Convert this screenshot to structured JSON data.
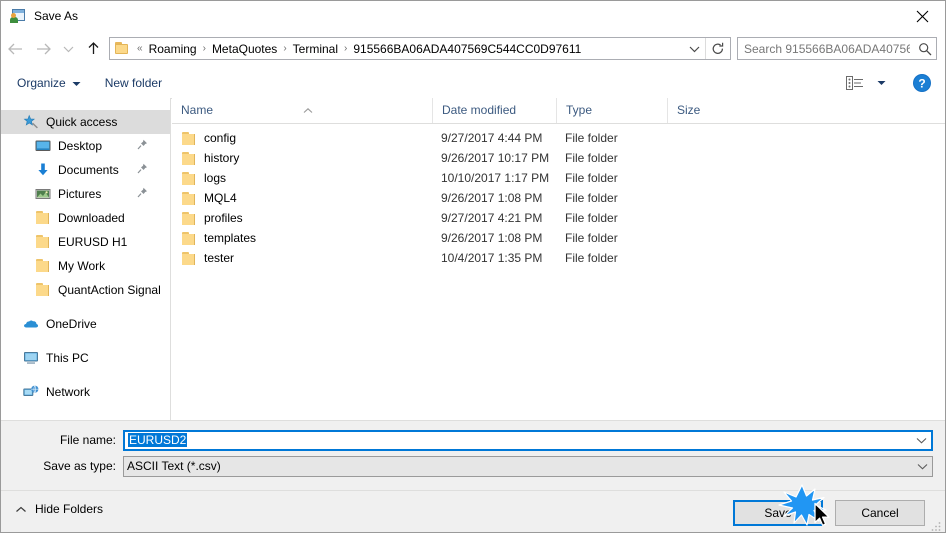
{
  "window": {
    "title": "Save As",
    "app_icon": "save-as-app-icon",
    "close_label": "✕"
  },
  "nav": {
    "back_icon": "arrow-left-icon",
    "forward_icon": "arrow-right-icon",
    "recent_icon": "chevron-down-icon",
    "up_icon": "arrow-up-icon",
    "breadcrumb_prefix": "«",
    "breadcrumbs": [
      "Roaming",
      "MetaQuotes",
      "Terminal",
      "915566BA06ADA407569C544CC0D97611"
    ],
    "separator": "›",
    "dropdown_icon": "chevron-down-icon",
    "refresh_icon": "refresh-icon"
  },
  "search": {
    "placeholder": "Search 915566BA06ADA40756...",
    "value": "",
    "icon": "search-icon"
  },
  "toolbar": {
    "organize_label": "Organize",
    "organize_icon": "chevron-down-icon",
    "new_folder_label": "New folder",
    "view_icon": "view-list-icon",
    "view_dropdown_icon": "chevron-down-icon",
    "help_icon": "help-icon",
    "help_label": "?"
  },
  "sidebar": {
    "groups": [
      {
        "items": [
          {
            "label": "Quick access",
            "icon": "star-pin-icon",
            "selected": true,
            "indent": false,
            "pinned": false
          },
          {
            "label": "Desktop",
            "icon": "desktop-icon",
            "selected": false,
            "indent": true,
            "pinned": true
          },
          {
            "label": "Documents",
            "icon": "documents-icon",
            "selected": false,
            "indent": true,
            "pinned": true
          },
          {
            "label": "Pictures",
            "icon": "pictures-icon",
            "selected": false,
            "indent": true,
            "pinned": true
          },
          {
            "label": "Downloaded",
            "icon": "folder-icon",
            "selected": false,
            "indent": true,
            "pinned": false
          },
          {
            "label": "EURUSD H1",
            "icon": "folder-icon",
            "selected": false,
            "indent": true,
            "pinned": false
          },
          {
            "label": "My Work",
            "icon": "folder-icon",
            "selected": false,
            "indent": true,
            "pinned": false
          },
          {
            "label": "QuantAction Signal",
            "icon": "folder-icon",
            "selected": false,
            "indent": true,
            "pinned": false
          }
        ]
      },
      {
        "items": [
          {
            "label": "OneDrive",
            "icon": "onedrive-cloud-icon",
            "selected": false,
            "indent": false,
            "pinned": false
          }
        ]
      },
      {
        "items": [
          {
            "label": "This PC",
            "icon": "this-pc-icon",
            "selected": false,
            "indent": false,
            "pinned": false
          }
        ]
      },
      {
        "items": [
          {
            "label": "Network",
            "icon": "network-icon",
            "selected": false,
            "indent": false,
            "pinned": false
          }
        ]
      }
    ]
  },
  "filelist": {
    "columns": [
      "Name",
      "Date modified",
      "Type",
      "Size"
    ],
    "sort_column": "Name",
    "sort_direction": "ascending",
    "rows": [
      {
        "name": "config",
        "date": "9/27/2017 4:44 PM",
        "type": "File folder",
        "size": ""
      },
      {
        "name": "history",
        "date": "9/26/2017 10:17 PM",
        "type": "File folder",
        "size": ""
      },
      {
        "name": "logs",
        "date": "10/10/2017 1:17 PM",
        "type": "File folder",
        "size": ""
      },
      {
        "name": "MQL4",
        "date": "9/26/2017 1:08 PM",
        "type": "File folder",
        "size": ""
      },
      {
        "name": "profiles",
        "date": "9/27/2017 4:21 PM",
        "type": "File folder",
        "size": ""
      },
      {
        "name": "templates",
        "date": "9/26/2017 1:08 PM",
        "type": "File folder",
        "size": ""
      },
      {
        "name": "tester",
        "date": "10/4/2017 1:35 PM",
        "type": "File folder",
        "size": ""
      }
    ]
  },
  "form": {
    "filename_label": "File name:",
    "filename_value": "EURUSD2",
    "filename_selected": true,
    "filetype_label": "Save as type:",
    "filetype_value": "ASCII Text (*.csv)",
    "dropdown_icon": "chevron-down-icon"
  },
  "footer": {
    "hide_folders_label": "Hide Folders",
    "hide_folders_icon": "chevron-up-icon",
    "save_label": "Save",
    "cancel_label": "Cancel"
  },
  "colors": {
    "accent": "#0078d7",
    "folder": "#fcd98a",
    "header_text": "#3c5a80",
    "toolbar_text": "#1b3a66",
    "chrome_bg": "#f0f0f0"
  }
}
